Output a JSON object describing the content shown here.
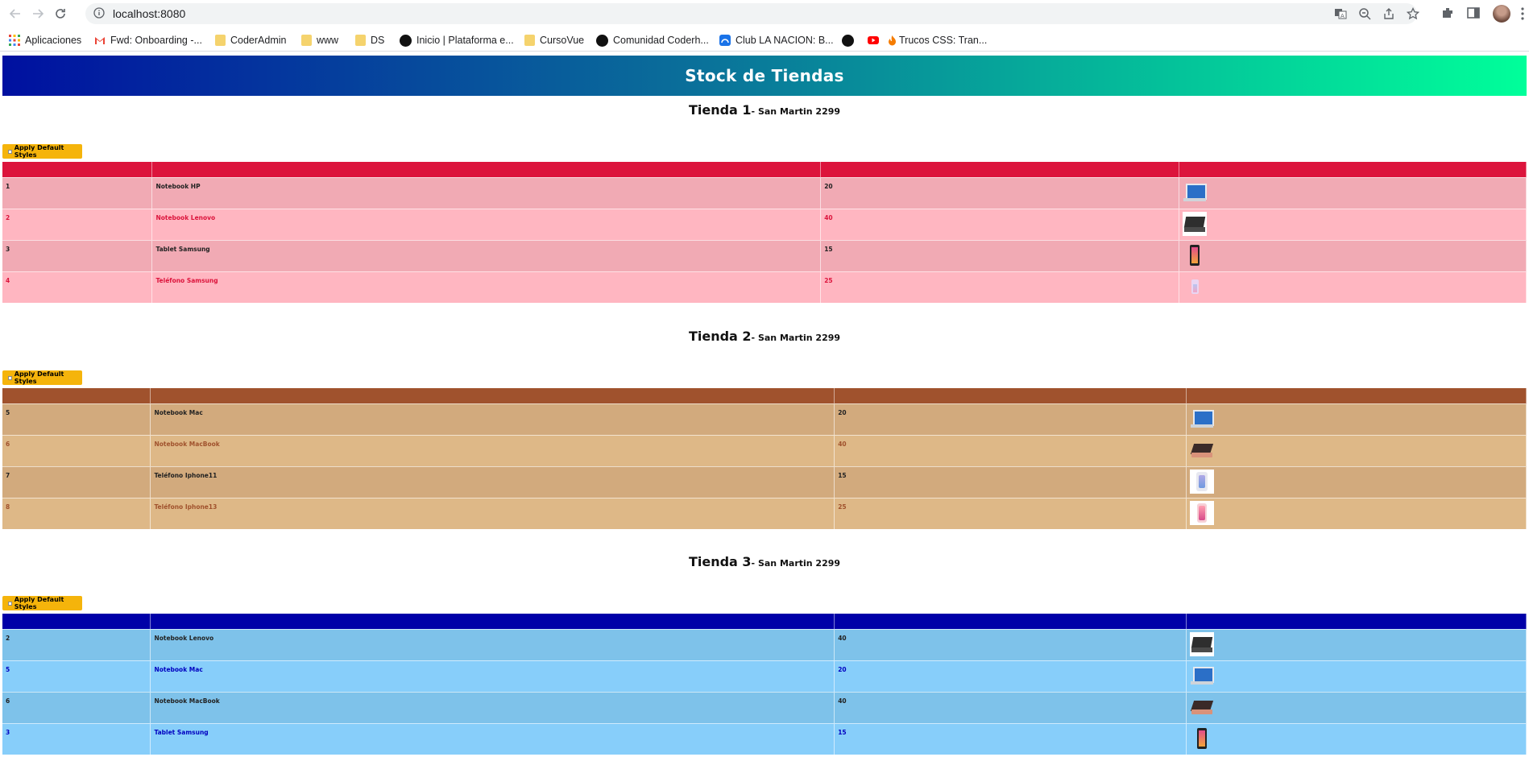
{
  "browser": {
    "url": "localhost:8080",
    "bookmarks": [
      {
        "label": "Aplicaciones",
        "icon": "apps-grid-icon"
      },
      {
        "label": "Fwd: Onboarding -...",
        "icon": "gmail-icon"
      },
      {
        "label": "CoderAdmin",
        "icon": "folder-icon"
      },
      {
        "label": "www",
        "icon": "folder-icon"
      },
      {
        "label": "DS",
        "icon": "folder-icon"
      },
      {
        "label": "Inicio | Plataforma e...",
        "icon": "coder-icon"
      },
      {
        "label": "CursoVue",
        "icon": "folder-icon"
      },
      {
        "label": "Comunidad Coderh...",
        "icon": "coder-icon"
      },
      {
        "label": "Club LA NACION: B...",
        "icon": "club-icon"
      },
      {
        "label": "",
        "icon": "coder-icon"
      },
      {
        "label": "",
        "icon": "youtube-icon"
      },
      {
        "label": "Trucos CSS: Tran...",
        "icon": "flame-icon"
      }
    ]
  },
  "page": {
    "title": "Stock de Tiendas",
    "apply_label": "Apply Default Styles"
  },
  "stores": [
    {
      "name": "Tienda 1",
      "address": "- San Martin 2299",
      "colors": {
        "header": "#dc143c",
        "odd_bg": "#f1aab4",
        "even_bg": "#ffb6c1",
        "odd_text": "#222222",
        "even_text": "#dc143c"
      },
      "rows": [
        {
          "id": "1",
          "product": "Notebook HP",
          "stock": "20",
          "image": "laptop-blue"
        },
        {
          "id": "2",
          "product": "Notebook Lenovo",
          "stock": "40",
          "image": "laptop-black"
        },
        {
          "id": "3",
          "product": "Tablet Samsung",
          "stock": "15",
          "image": "tablet"
        },
        {
          "id": "4",
          "product": "Teléfono Samsung",
          "stock": "25",
          "image": "phone-pink"
        }
      ]
    },
    {
      "name": "Tienda 2",
      "address": "- San Martin 2299",
      "colors": {
        "header": "#a0522d",
        "odd_bg": "#d2aa7d",
        "even_bg": "#deb887",
        "odd_text": "#222222",
        "even_text": "#a0522d"
      },
      "rows": [
        {
          "id": "5",
          "product": "Notebook Mac",
          "stock": "20",
          "image": "laptop-blue"
        },
        {
          "id": "6",
          "product": "Notebook MacBook",
          "stock": "40",
          "image": "macbook"
        },
        {
          "id": "7",
          "product": "Teléfono Iphone11",
          "stock": "15",
          "image": "iphone-white"
        },
        {
          "id": "8",
          "product": "Teléfono Iphone13",
          "stock": "25",
          "image": "iphone-pink"
        }
      ]
    },
    {
      "name": "Tienda 3",
      "address": "- San Martin 2299",
      "colors": {
        "header": "#0000a8",
        "odd_bg": "#7ec2ea",
        "even_bg": "#87cefa",
        "odd_text": "#222222",
        "even_text": "#0000c0"
      },
      "rows": [
        {
          "id": "2",
          "product": "Notebook Lenovo",
          "stock": "40",
          "image": "laptop-black"
        },
        {
          "id": "5",
          "product": "Notebook Mac",
          "stock": "20",
          "image": "laptop-blue"
        },
        {
          "id": "6",
          "product": "Notebook MacBook",
          "stock": "40",
          "image": "macbook"
        },
        {
          "id": "3",
          "product": "Tablet Samsung",
          "stock": "15",
          "image": "tablet"
        }
      ]
    }
  ]
}
